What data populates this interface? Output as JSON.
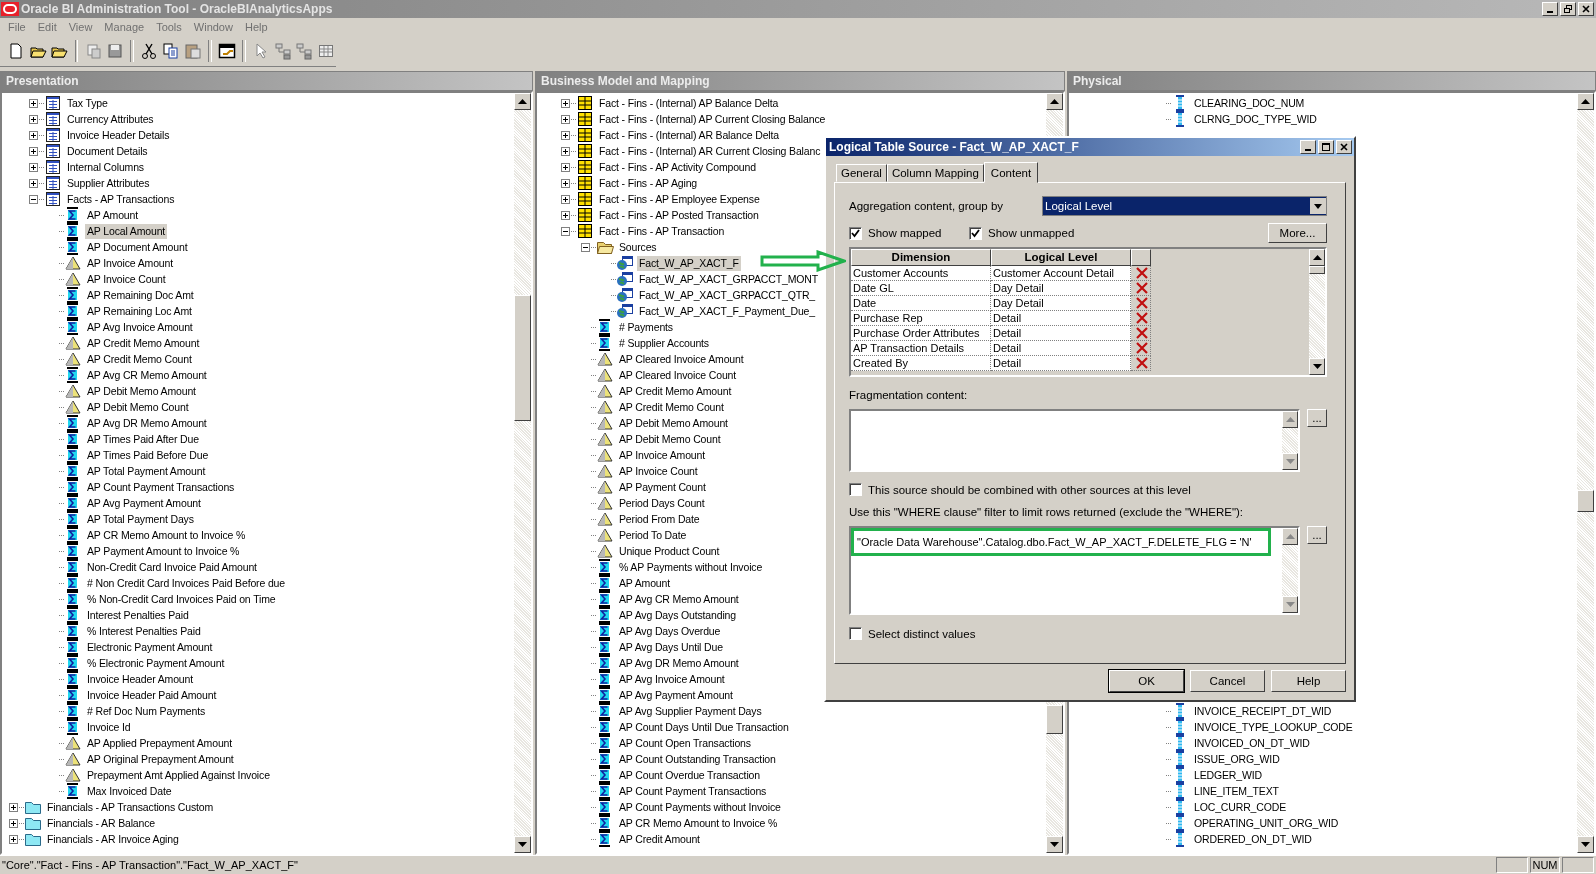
{
  "window": {
    "title": "Oracle BI Administration Tool - OracleBIAnalyticsApps"
  },
  "menu": [
    "File",
    "Edit",
    "View",
    "Manage",
    "Tools",
    "Window",
    "Help"
  ],
  "presentation": {
    "title": "Presentation",
    "continued_items": [
      {
        "label": "Tax Type",
        "kind": "table",
        "expanded": false,
        "selected": false
      },
      {
        "label": "Currency Attributes",
        "kind": "table",
        "expanded": false,
        "selected": false
      },
      {
        "label": "Invoice Header Details",
        "kind": "table",
        "expanded": false,
        "selected": false
      },
      {
        "label": "Document Details",
        "kind": "table",
        "expanded": false,
        "selected": false
      },
      {
        "label": "Internal Columns",
        "kind": "table",
        "expanded": false,
        "selected": false
      },
      {
        "label": "Supplier Attributes",
        "kind": "table",
        "expanded": false,
        "selected": false
      },
      {
        "label": "Facts - AP Transactions",
        "kind": "table",
        "expanded": true,
        "selected": false,
        "children": [
          {
            "label": "AP Amount",
            "kind": "measure",
            "selected": false
          },
          {
            "label": "AP Local Amount",
            "kind": "measure",
            "selected": true
          },
          {
            "label": "AP Document Amount",
            "kind": "measure",
            "selected": false
          },
          {
            "label": "AP Invoice Amount",
            "kind": "derived",
            "selected": false
          },
          {
            "label": "AP Invoice Count",
            "kind": "derived",
            "selected": false
          },
          {
            "label": "AP Remaining Doc Amt",
            "kind": "measure",
            "selected": false
          },
          {
            "label": "AP Remaining Loc Amt",
            "kind": "measure",
            "selected": false
          },
          {
            "label": "AP Avg Invoice Amount",
            "kind": "measure",
            "selected": false
          },
          {
            "label": "AP Credit Memo Amount",
            "kind": "derived",
            "selected": false
          },
          {
            "label": "AP Credit Memo Count",
            "kind": "derived",
            "selected": false
          },
          {
            "label": "AP Avg CR Memo Amount",
            "kind": "measure",
            "selected": false
          },
          {
            "label": "AP Debit Memo Amount",
            "kind": "derived",
            "selected": false
          },
          {
            "label": "AP Debit Memo Count",
            "kind": "derived",
            "selected": false
          },
          {
            "label": "AP Avg DR Memo Amount",
            "kind": "measure",
            "selected": false
          },
          {
            "label": "AP Times Paid After Due",
            "kind": "measure",
            "selected": false
          },
          {
            "label": "AP Times Paid Before Due",
            "kind": "measure",
            "selected": false
          },
          {
            "label": "AP Total Payment Amount",
            "kind": "measure",
            "selected": false
          },
          {
            "label": "AP Count Payment Transactions",
            "kind": "measure",
            "selected": false
          },
          {
            "label": "AP Avg Payment Amount",
            "kind": "measure",
            "selected": false
          },
          {
            "label": "AP Total Payment Days",
            "kind": "measure",
            "selected": false
          },
          {
            "label": "AP CR Memo Amount to Invoice %",
            "kind": "measure",
            "selected": false
          },
          {
            "label": "AP Payment Amount to Invoice %",
            "kind": "measure",
            "selected": false
          },
          {
            "label": "Non-Credit Card Invoice Paid Amount",
            "kind": "measure",
            "selected": false
          },
          {
            "label": "# Non Credit Card Invoices Paid Before due",
            "kind": "measure",
            "selected": false
          },
          {
            "label": "% Non-Credit Card Invoices Paid on Time",
            "kind": "measure",
            "selected": false
          },
          {
            "label": "Interest Penalties Paid",
            "kind": "measure",
            "selected": false
          },
          {
            "label": "% Interest Penalties Paid",
            "kind": "measure",
            "selected": false
          },
          {
            "label": "Electronic Payment Amount",
            "kind": "measure",
            "selected": false
          },
          {
            "label": "% Electronic Payment Amount",
            "kind": "measure",
            "selected": false
          },
          {
            "label": "Invoice Header Amount",
            "kind": "measure",
            "selected": false
          },
          {
            "label": "Invoice Header Paid Amount",
            "kind": "measure",
            "selected": false
          },
          {
            "label": "# Ref Doc Num Payments",
            "kind": "measure",
            "selected": false
          },
          {
            "label": "Invoice Id",
            "kind": "measure",
            "selected": false
          },
          {
            "label": "AP Applied Prepayment Amount",
            "kind": "derived",
            "selected": false
          },
          {
            "label": "AP Original Prepayment Amount",
            "kind": "derived",
            "selected": false
          },
          {
            "label": "Prepayment Amt Applied Against Invoice",
            "kind": "derived",
            "selected": false
          },
          {
            "label": "Max Invoiced Date",
            "kind": "measure",
            "selected": false
          }
        ]
      }
    ],
    "items": [
      {
        "label": "Financials - AP Transactions Custom",
        "kind": "folder",
        "expanded": false,
        "selected": false
      },
      {
        "label": "Financials - AR Balance",
        "kind": "folder",
        "expanded": false,
        "selected": false
      },
      {
        "label": "Financials - AR Invoice Aging",
        "kind": "folder",
        "expanded": false,
        "selected": false
      }
    ]
  },
  "business_model": {
    "title": "Business Model and Mapping",
    "continued_items": [
      {
        "label": "Fact - Fins - (Internal) AP Balance Delta",
        "kind": "logical-table",
        "expanded": false,
        "selected": false
      },
      {
        "label": "Fact - Fins - (Internal) AP Current Closing Balance",
        "kind": "logical-table",
        "expanded": false,
        "selected": false
      },
      {
        "label": "Fact - Fins - (Internal) AR Balance Delta",
        "kind": "logical-table",
        "expanded": false,
        "selected": false
      },
      {
        "label": "Fact - Fins - (Internal) AR Current Closing Balanc",
        "kind": "logical-table",
        "expanded": false,
        "selected": false
      },
      {
        "label": "Fact - Fins - AP Activity Compound",
        "kind": "logical-table",
        "expanded": false,
        "selected": false
      },
      {
        "label": "Fact - Fins - AP Aging",
        "kind": "logical-table",
        "expanded": false,
        "selected": false
      },
      {
        "label": "Fact - Fins - AP Employee Expense",
        "kind": "logical-table",
        "expanded": false,
        "selected": false
      },
      {
        "label": "Fact - Fins - AP Posted Transaction",
        "kind": "logical-table",
        "expanded": false,
        "selected": false
      },
      {
        "label": "Fact - Fins - AP Transaction",
        "kind": "logical-table",
        "expanded": true,
        "selected": false,
        "children": [
          {
            "label": "Sources",
            "kind": "sources-folder",
            "expanded": true,
            "selected": false,
            "children": [
              {
                "label": "Fact_W_AP_XACT_F",
                "kind": "source",
                "selected": true
              },
              {
                "label": "Fact_W_AP_XACT_GRPACCT_MONT",
                "kind": "source",
                "selected": false
              },
              {
                "label": "Fact_W_AP_XACT_GRPACCT_QTR_",
                "kind": "source",
                "selected": false
              },
              {
                "label": "Fact_W_AP_XACT_F_Payment_Due_",
                "kind": "source",
                "selected": false
              }
            ]
          },
          {
            "label": "# Payments",
            "kind": "measure",
            "selected": false
          },
          {
            "label": "# Supplier Accounts",
            "kind": "measure",
            "selected": false
          },
          {
            "label": "AP Cleared Invoice Amount",
            "kind": "derived",
            "selected": false
          },
          {
            "label": "AP Cleared Invoice Count",
            "kind": "derived",
            "selected": false
          },
          {
            "label": "AP Credit Memo Amount",
            "kind": "derived",
            "selected": false
          },
          {
            "label": "AP Credit Memo Count",
            "kind": "derived",
            "selected": false
          },
          {
            "label": "AP Debit Memo Amount",
            "kind": "derived",
            "selected": false
          },
          {
            "label": "AP Debit Memo Count",
            "kind": "derived",
            "selected": false
          },
          {
            "label": "AP Invoice Amount",
            "kind": "derived",
            "selected": false
          },
          {
            "label": "AP Invoice Count",
            "kind": "derived",
            "selected": false
          },
          {
            "label": "AP Payment Count",
            "kind": "derived",
            "selected": false
          },
          {
            "label": "Period Days Count",
            "kind": "derived",
            "selected": false
          },
          {
            "label": "Period From Date",
            "kind": "derived",
            "selected": false
          },
          {
            "label": "Period To Date",
            "kind": "derived",
            "selected": false
          },
          {
            "label": "Unique Product Count",
            "kind": "derived",
            "selected": false
          },
          {
            "label": "% AP Payments without Invoice",
            "kind": "measure",
            "selected": false
          },
          {
            "label": "AP Amount",
            "kind": "measure",
            "selected": false
          },
          {
            "label": "AP Avg CR Memo Amount",
            "kind": "measure",
            "selected": false
          },
          {
            "label": "AP Avg Days Outstanding",
            "kind": "measure",
            "selected": false
          },
          {
            "label": "AP Avg Days Overdue",
            "kind": "measure",
            "selected": false
          },
          {
            "label": "AP Avg Days Until Due",
            "kind": "measure",
            "selected": false
          },
          {
            "label": "AP Avg DR Memo Amount",
            "kind": "measure",
            "selected": false
          },
          {
            "label": "AP Avg Invoice Amount",
            "kind": "measure",
            "selected": false
          },
          {
            "label": "AP Avg Payment Amount",
            "kind": "measure",
            "selected": false
          },
          {
            "label": "AP Avg Supplier Payment Days",
            "kind": "measure",
            "selected": false
          },
          {
            "label": "AP Count Days Until Due Transaction",
            "kind": "measure",
            "selected": false
          },
          {
            "label": "AP Count Open Transactions",
            "kind": "measure",
            "selected": false
          },
          {
            "label": "AP Count Outstanding Transaction",
            "kind": "measure",
            "selected": false
          },
          {
            "label": "AP Count Overdue Transaction",
            "kind": "measure",
            "selected": false
          },
          {
            "label": "AP Count Payment Transactions",
            "kind": "measure",
            "selected": false
          },
          {
            "label": "AP Count Payments without Invoice",
            "kind": "measure",
            "selected": false
          },
          {
            "label": "AP CR Memo Amount to Invoice %",
            "kind": "measure",
            "selected": false
          },
          {
            "label": "AP Credit Amount",
            "kind": "measure",
            "selected": false
          }
        ]
      }
    ]
  },
  "physical": {
    "title": "Physical",
    "columns_top": [
      {
        "label": "CLEARING_DOC_NUM",
        "kind": "column",
        "selected": false
      },
      {
        "label": "CLRNG_DOC_TYPE_WID",
        "kind": "column",
        "selected": false
      }
    ],
    "columns_bottom": [
      {
        "label": "INVOICE_RECEIPT_DT_WID",
        "kind": "column",
        "selected": false
      },
      {
        "label": "INVOICE_TYPE_LOOKUP_CODE",
        "kind": "column",
        "selected": false
      },
      {
        "label": "INVOICED_ON_DT_WID",
        "kind": "column",
        "selected": false
      },
      {
        "label": "ISSUE_ORG_WID",
        "kind": "column",
        "selected": false
      },
      {
        "label": "LEDGER_WID",
        "kind": "column",
        "selected": false
      },
      {
        "label": "LINE_ITEM_TEXT",
        "kind": "column",
        "selected": false
      },
      {
        "label": "LOC_CURR_CODE",
        "kind": "column",
        "selected": false
      },
      {
        "label": "OPERATING_UNIT_ORG_WID",
        "kind": "column",
        "selected": false
      },
      {
        "label": "ORDERED_ON_DT_WID",
        "kind": "column",
        "selected": false
      }
    ]
  },
  "dialog": {
    "title": "Logical Table Source - Fact_W_AP_XACT_F",
    "tabs": [
      {
        "label": "General",
        "selected": false
      },
      {
        "label": "Column Mapping",
        "selected": false
      },
      {
        "label": "Content",
        "selected": true
      }
    ],
    "aggregation_label": "Aggregation content, group by",
    "aggregation_value": "Logical Level",
    "show_mapped": {
      "label": "Show mapped",
      "checked": true
    },
    "show_unmapped": {
      "label": "Show unmapped",
      "checked": true
    },
    "more_button": "More...",
    "levels_table": {
      "columns": [
        "Dimension",
        "Logical Level"
      ],
      "rows": [
        {
          "dimension": "Customer Accounts",
          "level": "Customer Account Detail"
        },
        {
          "dimension": "Date GL",
          "level": "Day Detail"
        },
        {
          "dimension": "Date",
          "level": "Day Detail"
        },
        {
          "dimension": "Purchase Rep",
          "level": "Detail"
        },
        {
          "dimension": "Purchase Order Attributes",
          "level": "Detail"
        },
        {
          "dimension": "AP Transaction Details",
          "level": "Detail"
        },
        {
          "dimension": "Created By",
          "level": "Detail"
        }
      ]
    },
    "fragmentation_label": "Fragmentation content:",
    "fragmentation_button": "...",
    "combine_sources": {
      "label": "This source should be combined with other sources at this level",
      "checked": false
    },
    "where_label": "Use this \"WHERE clause\" filter to limit rows returned (exclude the \"WHERE\"):",
    "where_value": "\"Oracle Data Warehouse\".Catalog.dbo.Fact_W_AP_XACT_F.DELETE_FLG = 'N'",
    "where_button": "...",
    "select_distinct": {
      "label": "Select distinct values",
      "checked": false
    },
    "buttons": [
      "OK",
      "Cancel",
      "Help"
    ]
  },
  "status_bar": {
    "path": "\"Core\".\"Fact - Fins - AP Transaction\".\"Fact_W_AP_XACT_F\"",
    "indicators": [
      "NUM"
    ]
  }
}
